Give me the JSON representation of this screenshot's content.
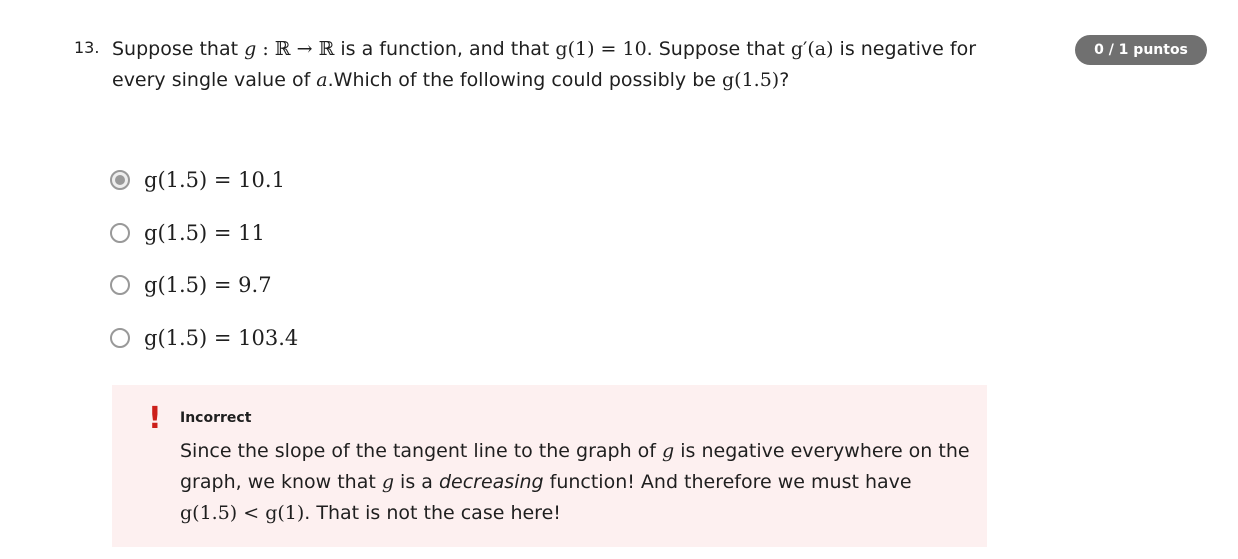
{
  "question": {
    "number": "13.",
    "intro": "Suppose that ",
    "g": "g",
    "colon": " : ",
    "R1": "ℝ",
    "arrow": " → ",
    "R2": "ℝ",
    "mid1": " is a function, and that ",
    "g_of_1": "g(1) = 10",
    "mid2": ". Suppose that ",
    "g_prime_a": "g′(a)",
    "mid3": " is negative for every single value of ",
    "a": "a",
    "mid4": ".Which of the following could possibly be ",
    "g_15": "g(1.5)",
    "end": "?"
  },
  "score_badge": "0 / 1 puntos",
  "options": [
    {
      "label": "g(1.5) = 10.1",
      "selected": true
    },
    {
      "label": "g(1.5) = 11",
      "selected": false
    },
    {
      "label": "g(1.5) = 9.7",
      "selected": false
    },
    {
      "label": "g(1.5) = 103.4",
      "selected": false
    }
  ],
  "feedback": {
    "icon": "!",
    "title": "Incorrect",
    "p1": "Since the slope of the tangent line to the graph of ",
    "g1": "g",
    "p2": " is negative everywhere on the graph, we know that ",
    "g2": "g",
    "p3": " is a ",
    "emph": "decreasing",
    "p4": " function! And therefore we must have ",
    "inequality": "g(1.5) < g(1)",
    "p5": ". That is not the case here!"
  },
  "colors": {
    "badge": "#707070",
    "feedback_bg": "#fdf0f0",
    "error": "#cc1f1a"
  }
}
